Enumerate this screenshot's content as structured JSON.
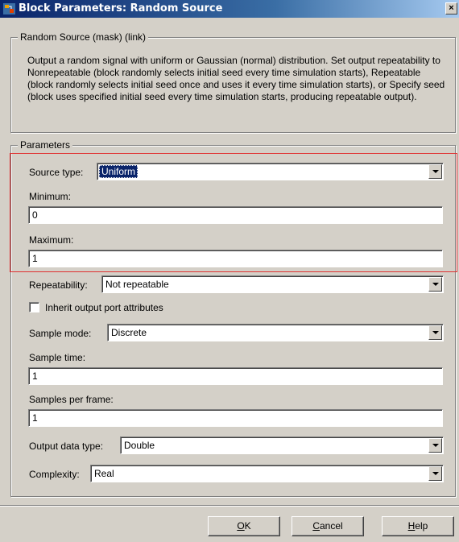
{
  "window": {
    "title": "Block Parameters: Random Source",
    "close_glyph": "×"
  },
  "mask_group": {
    "legend": "Random Source (mask) (link)",
    "description": "Output a random signal with uniform or Gaussian (normal) distribution.  Set output repeatability to Nonrepeatable (block randomly selects initial seed every time simulation starts), Repeatable (block randomly selects initial seed once and uses it every time simulation starts), or Specify seed (block uses specified initial seed every time simulation starts, producing repeatable output)."
  },
  "params_group": {
    "legend": "Parameters",
    "source_type": {
      "label": "Source type:",
      "value": "Uniform"
    },
    "minimum": {
      "label": "Minimum:",
      "value": "0"
    },
    "maximum": {
      "label": "Maximum:",
      "value": "1"
    },
    "repeatability": {
      "label": "Repeatability:",
      "value": "Not repeatable"
    },
    "inherit": {
      "label": "Inherit output port attributes",
      "checked": false
    },
    "sample_mode": {
      "label": "Sample mode:",
      "value": "Discrete"
    },
    "sample_time": {
      "label": "Sample time:",
      "value": "1"
    },
    "samples_per_frame": {
      "label": "Samples per frame:",
      "value": "1"
    },
    "output_data_type": {
      "label": "Output data type:",
      "value": "Double"
    },
    "complexity": {
      "label": "Complexity:",
      "value": "Real"
    }
  },
  "buttons": {
    "ok": {
      "mnemonic": "O",
      "rest": "K"
    },
    "cancel": {
      "mnemonic": "C",
      "rest": "ancel"
    },
    "help": {
      "mnemonic": "H",
      "rest": "elp"
    }
  },
  "colors": {
    "title_bar": "#0a246a",
    "face": "#d4d0c8",
    "highlight_box": "#e03030",
    "selection": "#0a246a"
  }
}
